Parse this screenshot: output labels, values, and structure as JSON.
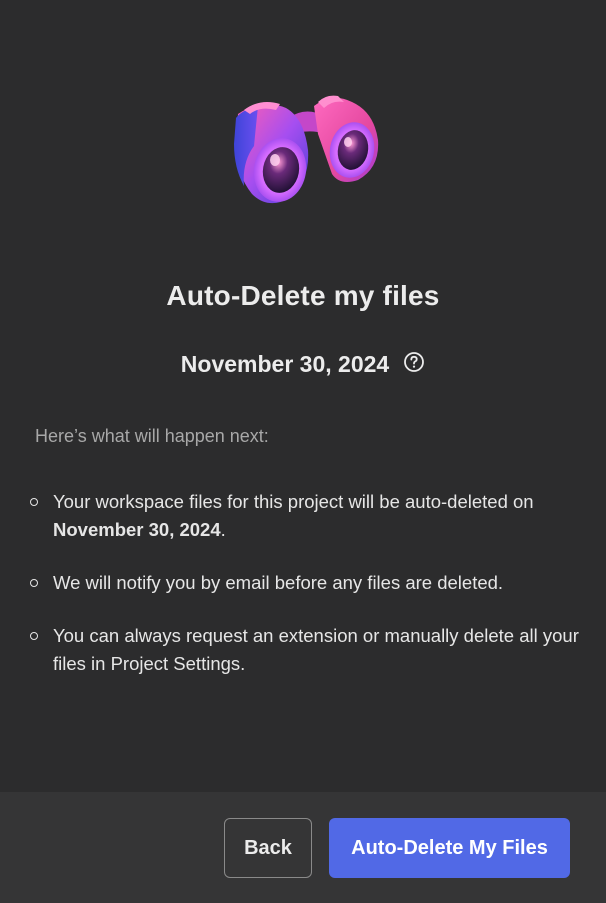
{
  "dialog": {
    "title": "Auto-Delete my files",
    "date": "November 30, 2024",
    "intro": "Here’s what will happen next:",
    "bullets": [
      {
        "before": "Your workspace files for this project will be auto-deleted on ",
        "bold": "November 30, 2024",
        "after": "."
      },
      {
        "text": "We will notify you by email before any files are deleted."
      },
      {
        "text": "You can always request an extension or manually delete all your files in Project Settings."
      }
    ]
  },
  "icons": {
    "hero": "binoculars-icon",
    "help": "question-circle-icon"
  },
  "footer": {
    "back_label": "Back",
    "primary_label": "Auto-Delete My Files"
  },
  "colors": {
    "background": "#2c2c2d",
    "footer_background": "#353536",
    "primary_button": "#5169e6",
    "binocular_pink": "#e94fa8",
    "binocular_purple": "#8a4fe8"
  }
}
